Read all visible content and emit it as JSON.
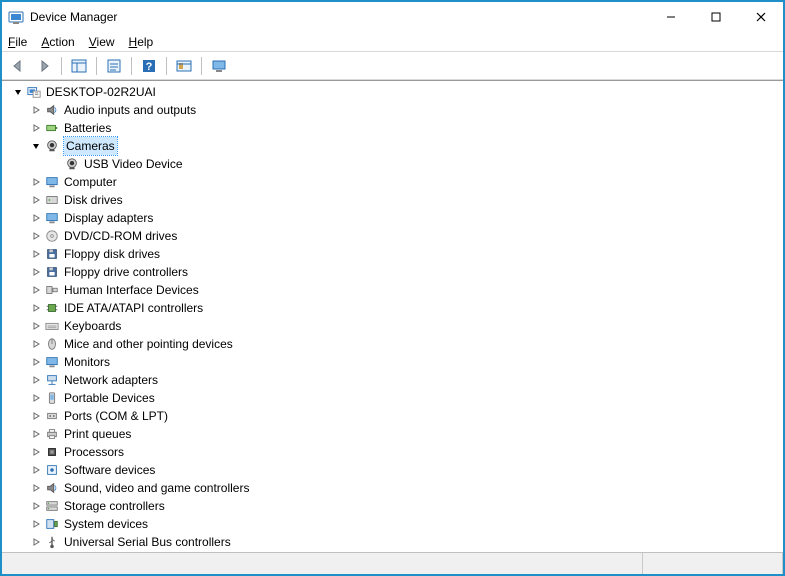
{
  "window": {
    "title": "Device Manager"
  },
  "menu": {
    "file": "File",
    "action": "Action",
    "view": "View",
    "help": "Help"
  },
  "tree": {
    "root": "DESKTOP-02R2UAI",
    "categories": [
      {
        "label": "Audio inputs and outputs",
        "expanded": false,
        "icon": "speaker"
      },
      {
        "label": "Batteries",
        "expanded": false,
        "icon": "battery"
      },
      {
        "label": "Cameras",
        "expanded": true,
        "icon": "webcam",
        "selected": true,
        "children": [
          {
            "label": "USB Video Device",
            "icon": "webcam"
          }
        ]
      },
      {
        "label": "Computer",
        "expanded": false,
        "icon": "monitor"
      },
      {
        "label": "Disk drives",
        "expanded": false,
        "icon": "hdd"
      },
      {
        "label": "Display adapters",
        "expanded": false,
        "icon": "monitor"
      },
      {
        "label": "DVD/CD-ROM drives",
        "expanded": false,
        "icon": "disc"
      },
      {
        "label": "Floppy disk drives",
        "expanded": false,
        "icon": "floppy"
      },
      {
        "label": "Floppy drive controllers",
        "expanded": false,
        "icon": "floppy"
      },
      {
        "label": "Human Interface Devices",
        "expanded": false,
        "icon": "hid"
      },
      {
        "label": "IDE ATA/ATAPI controllers",
        "expanded": false,
        "icon": "chip"
      },
      {
        "label": "Keyboards",
        "expanded": false,
        "icon": "keyboard"
      },
      {
        "label": "Mice and other pointing devices",
        "expanded": false,
        "icon": "mouse"
      },
      {
        "label": "Monitors",
        "expanded": false,
        "icon": "monitor"
      },
      {
        "label": "Network adapters",
        "expanded": false,
        "icon": "network"
      },
      {
        "label": "Portable Devices",
        "expanded": false,
        "icon": "portable"
      },
      {
        "label": "Ports (COM & LPT)",
        "expanded": false,
        "icon": "port"
      },
      {
        "label": "Print queues",
        "expanded": false,
        "icon": "printer"
      },
      {
        "label": "Processors",
        "expanded": false,
        "icon": "cpu"
      },
      {
        "label": "Software devices",
        "expanded": false,
        "icon": "software"
      },
      {
        "label": "Sound, video and game controllers",
        "expanded": false,
        "icon": "speaker"
      },
      {
        "label": "Storage controllers",
        "expanded": false,
        "icon": "storage"
      },
      {
        "label": "System devices",
        "expanded": false,
        "icon": "system"
      },
      {
        "label": "Universal Serial Bus controllers",
        "expanded": false,
        "icon": "usb"
      }
    ]
  }
}
